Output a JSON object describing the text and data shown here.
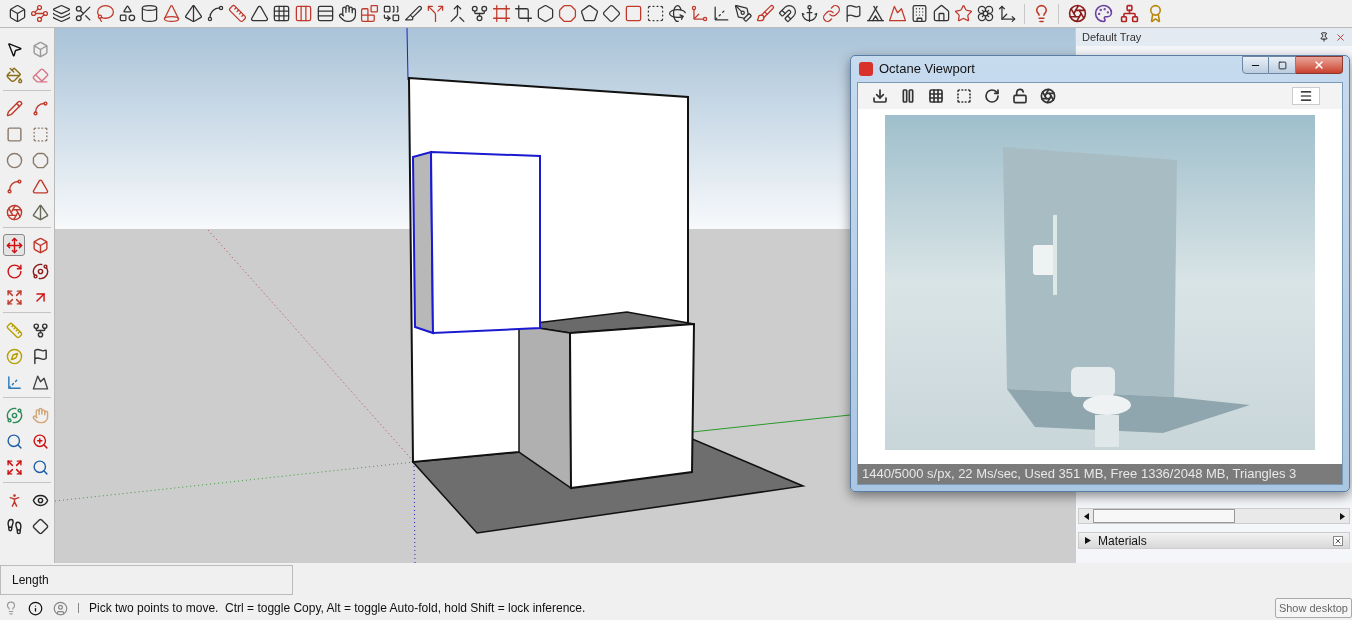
{
  "left_toolbar": {
    "groups": [
      {
        "tools": [
          {
            "selected": false
          },
          {
            "selected": false
          },
          {
            "selected": false
          },
          {
            "selected": false
          }
        ]
      },
      {
        "tools": [
          {
            "selected": false
          },
          {
            "selected": false
          },
          {
            "selected": false
          },
          {
            "selected": false
          },
          {
            "selected": false
          },
          {
            "selected": false
          },
          {
            "selected": false
          },
          {
            "selected": false
          },
          {
            "selected": false
          },
          {
            "selected": false
          }
        ]
      },
      {
        "tools": [
          {
            "selected": true
          },
          {
            "selected": false
          },
          {
            "selected": false
          },
          {
            "selected": false
          },
          {
            "selected": false
          },
          {
            "selected": false
          }
        ]
      },
      {
        "tools": [
          {
            "selected": false
          },
          {
            "selected": false
          },
          {
            "selected": false
          },
          {
            "selected": false
          },
          {
            "selected": false
          },
          {
            "selected": false
          }
        ]
      },
      {
        "tools": [
          {
            "selected": false
          },
          {
            "selected": false
          },
          {
            "selected": false
          },
          {
            "selected": false
          },
          {
            "selected": false
          },
          {
            "selected": false
          }
        ]
      },
      {
        "tools": [
          {
            "selected": false
          },
          {
            "selected": false
          },
          {
            "selected": false
          },
          {
            "selected": false
          }
        ]
      }
    ]
  },
  "tray": {
    "title": "Default Tray",
    "panels": [
      {
        "title": "Materials",
        "expanded": false
      }
    ]
  },
  "octane_window": {
    "title": "Octane Viewport",
    "status": "1440/5000 s/px, 22 Ms/sec, Used 351 MB, Free 1336/2048 MB, Triangles 3"
  },
  "measurements": {
    "label": "Length"
  },
  "status_bar": {
    "hint": "Pick two points to move.  Ctrl = toggle Copy, Alt = toggle Auto-fold, hold Shift = lock inference."
  },
  "taskbar": {
    "show_desktop": "Show desktop"
  }
}
